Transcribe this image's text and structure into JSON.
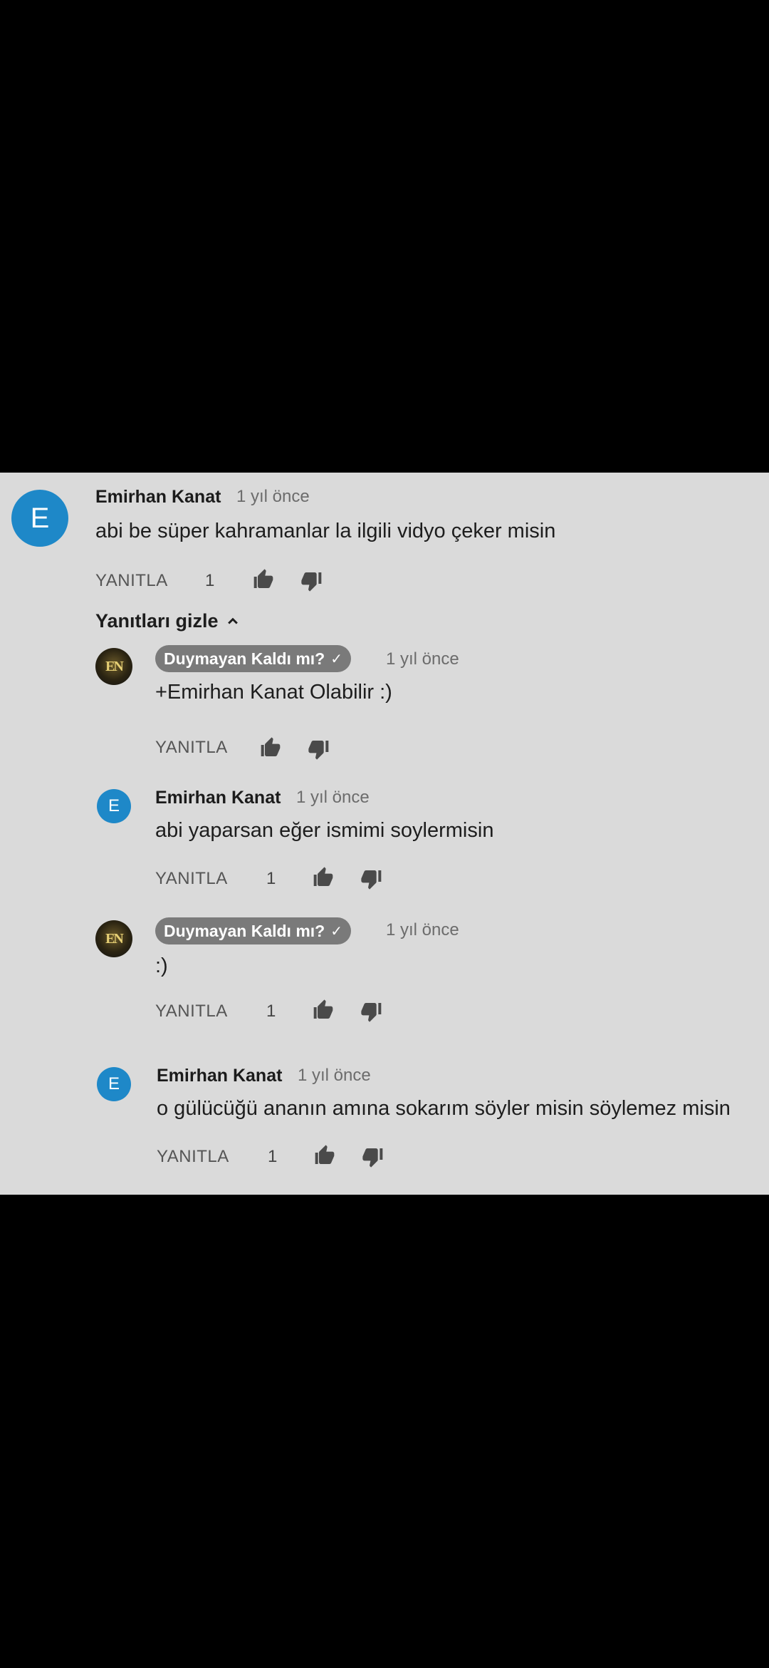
{
  "colors": {
    "background": "#dadada",
    "avatar_letter_bg": "#1e88c8",
    "badge_bg": "#7a7a7a"
  },
  "top_comment": {
    "avatar_letter": "E",
    "author": "Emirhan Kanat",
    "time": "1 yıl önce",
    "text": "abi be süper kahramanlar la ilgili vidyo çeker misin",
    "reply_label": "YANITLA",
    "likes": "1"
  },
  "replies_toggle": {
    "label": "Yanıtları gizle",
    "icon": "chevron-up-icon"
  },
  "replies": [
    {
      "avatar_logo": "EN",
      "author": "Duymayan Kaldı mı?",
      "verified_icon": "check-icon",
      "time": "1 yıl önce",
      "text": "+Emirhan Kanat Olabilir :)",
      "reply_label": "YANITLA",
      "likes": ""
    },
    {
      "avatar_letter": "E",
      "author": "Emirhan Kanat",
      "time": "1 yıl önce",
      "text": "abi yaparsan eğer ismimi soylermisin",
      "reply_label": "YANITLA",
      "likes": "1"
    },
    {
      "avatar_logo": "EN",
      "author": "Duymayan Kaldı mı?",
      "verified_icon": "check-icon",
      "time": "1 yıl önce",
      "text": ":)",
      "reply_label": "YANITLA",
      "likes": "1"
    },
    {
      "avatar_letter": "E",
      "author": "Emirhan Kanat",
      "time": "1 yıl önce",
      "text": "o gülücüğü ananın amına sokarım söyler misin söylemez misin",
      "reply_label": "YANITLA",
      "likes": "1"
    }
  ]
}
